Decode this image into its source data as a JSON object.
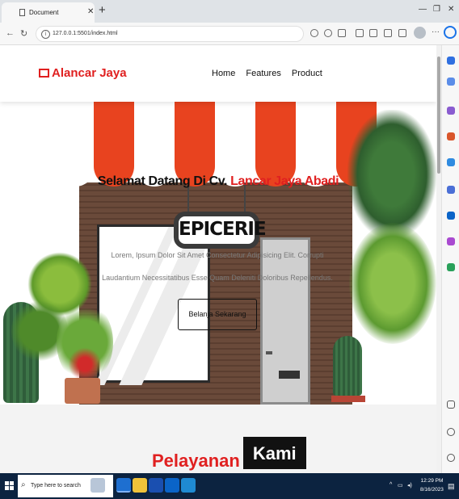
{
  "browser": {
    "tab_title": "Document",
    "url": "127.0.0.1:5501/index.html",
    "new_tab_symbol": "+",
    "close_symbol": "✕"
  },
  "site": {
    "brand": "Alancar Jaya",
    "nav": [
      "Home",
      "Features",
      "Product"
    ],
    "hero": {
      "title_prefix": "Selamat Datang Di Cv. ",
      "title_accent": "Lancar Jaya Abadi",
      "description": "Lorem, Ipsum Dolor Sit Amet Consectetur Adipisicing Elit. Corrupti Laudantium Necessitatibus Esse Quam Deleniti Doloribus Repellendus.",
      "sign_text": "EPICERIE",
      "button_label": "Belanja Sekarang"
    },
    "services": {
      "title_red": "Pelayanan",
      "title_box": "Kami"
    }
  },
  "taskbar": {
    "search_placeholder": "Type here to search",
    "time": "12:29 PM",
    "date": "8/16/2023"
  },
  "colors": {
    "accent": "#e02020",
    "awning_red": "#e8431f",
    "brick": "#6a4a3a",
    "taskbar": "#0c2340"
  }
}
